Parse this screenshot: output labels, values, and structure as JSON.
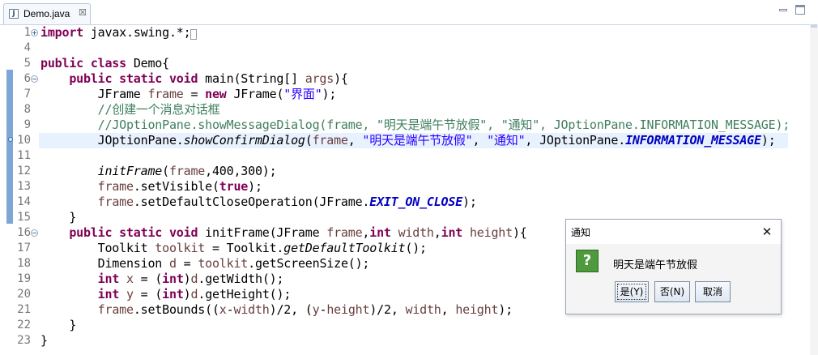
{
  "editor": {
    "tab_title": "Demo.java",
    "tab_close": "☒",
    "file_icon": "java-file-icon"
  },
  "code_lines": [
    {
      "num": "1",
      "html": "<span class='kw'>import</span> javax.swing.*;<span style='border:1px solid #999;font-size:10px;'>&nbsp;</span>"
    },
    {
      "num": "4",
      "html": ""
    },
    {
      "num": "5",
      "html": "<span class='kw'>public class</span> Demo{"
    },
    {
      "num": "6",
      "html": "    <span class='kw'>public static void</span> main(String[] <span class='var'>args</span>){"
    },
    {
      "num": "7",
      "html": "        JFrame <span class='var'>frame</span> = <span class='kw'>new</span> JFrame(<span class='str'>\"界面\"</span>);"
    },
    {
      "num": "8",
      "html": "        <span class='cmt'>//创建一个消息对话框</span>"
    },
    {
      "num": "9",
      "html": "        <span class='cmt'>//JOptionPane.showMessageDialog(frame, \"明天是端午节放假\", \"通知\", JOptionPane.INFORMATION_MESSAGE);</span>"
    },
    {
      "num": "10",
      "html": "        JOptionPane.<span class='itl'>showConfirmDialog</span>(<span class='var'>frame</span>, <span class='str'>\"明天是端午节放假\"</span>, <span class='str'>\"通知\"</span>, JOptionPane.<span class='sfld'>INFORMATION_MESSAGE</span>);"
    },
    {
      "num": "11",
      "html": ""
    },
    {
      "num": "12",
      "html": "        <span class='itl'>initFrame</span>(<span class='var'>frame</span>,400,300);"
    },
    {
      "num": "13",
      "html": "        <span class='var'>frame</span>.setVisible(<span class='kw'>true</span>);"
    },
    {
      "num": "14",
      "html": "        <span class='var'>frame</span>.setDefaultCloseOperation(JFrame.<span class='sfld'>EXIT_ON_CLOSE</span>);"
    },
    {
      "num": "15",
      "html": "    }"
    },
    {
      "num": "16",
      "html": "    <span class='kw'>public static void</span> initFrame(JFrame <span class='var'>frame</span>,<span class='kw'>int</span> <span class='var'>width</span>,<span class='kw'>int</span> <span class='var'>height</span>){"
    },
    {
      "num": "17",
      "html": "        Toolkit <span class='var'>toolkit</span> = Toolkit.<span class='itl'>getDefaultToolkit</span>();"
    },
    {
      "num": "18",
      "html": "        Dimension <span class='var'>d</span> = <span class='var'>toolkit</span>.getScreenSize();"
    },
    {
      "num": "19",
      "html": "        <span class='kw'>int</span> <span class='var'>x</span> = (<span class='kw'>int</span>)<span class='var'>d</span>.getWidth();"
    },
    {
      "num": "20",
      "html": "        <span class='kw'>int</span> <span class='var'>y</span> = (<span class='kw'>int</span>)<span class='var'>d</span>.getHeight();"
    },
    {
      "num": "21",
      "html": "        <span class='var'>frame</span>.setBounds((<span class='var'>x</span>-<span class='var'>width</span>)/2, (<span class='var'>y</span>-<span class='var'>height</span>)/2, <span class='var'>width</span>, <span class='var'>height</span>);"
    },
    {
      "num": "22",
      "html": "    }"
    },
    {
      "num": "23",
      "html": "}"
    }
  ],
  "dialog": {
    "title": "通知",
    "close": "✕",
    "message": "明天是端午节放假",
    "icon": "question-icon",
    "icon_glyph": "?",
    "yes": "是(Y)",
    "no": "否(N)",
    "cancel": "取消"
  }
}
